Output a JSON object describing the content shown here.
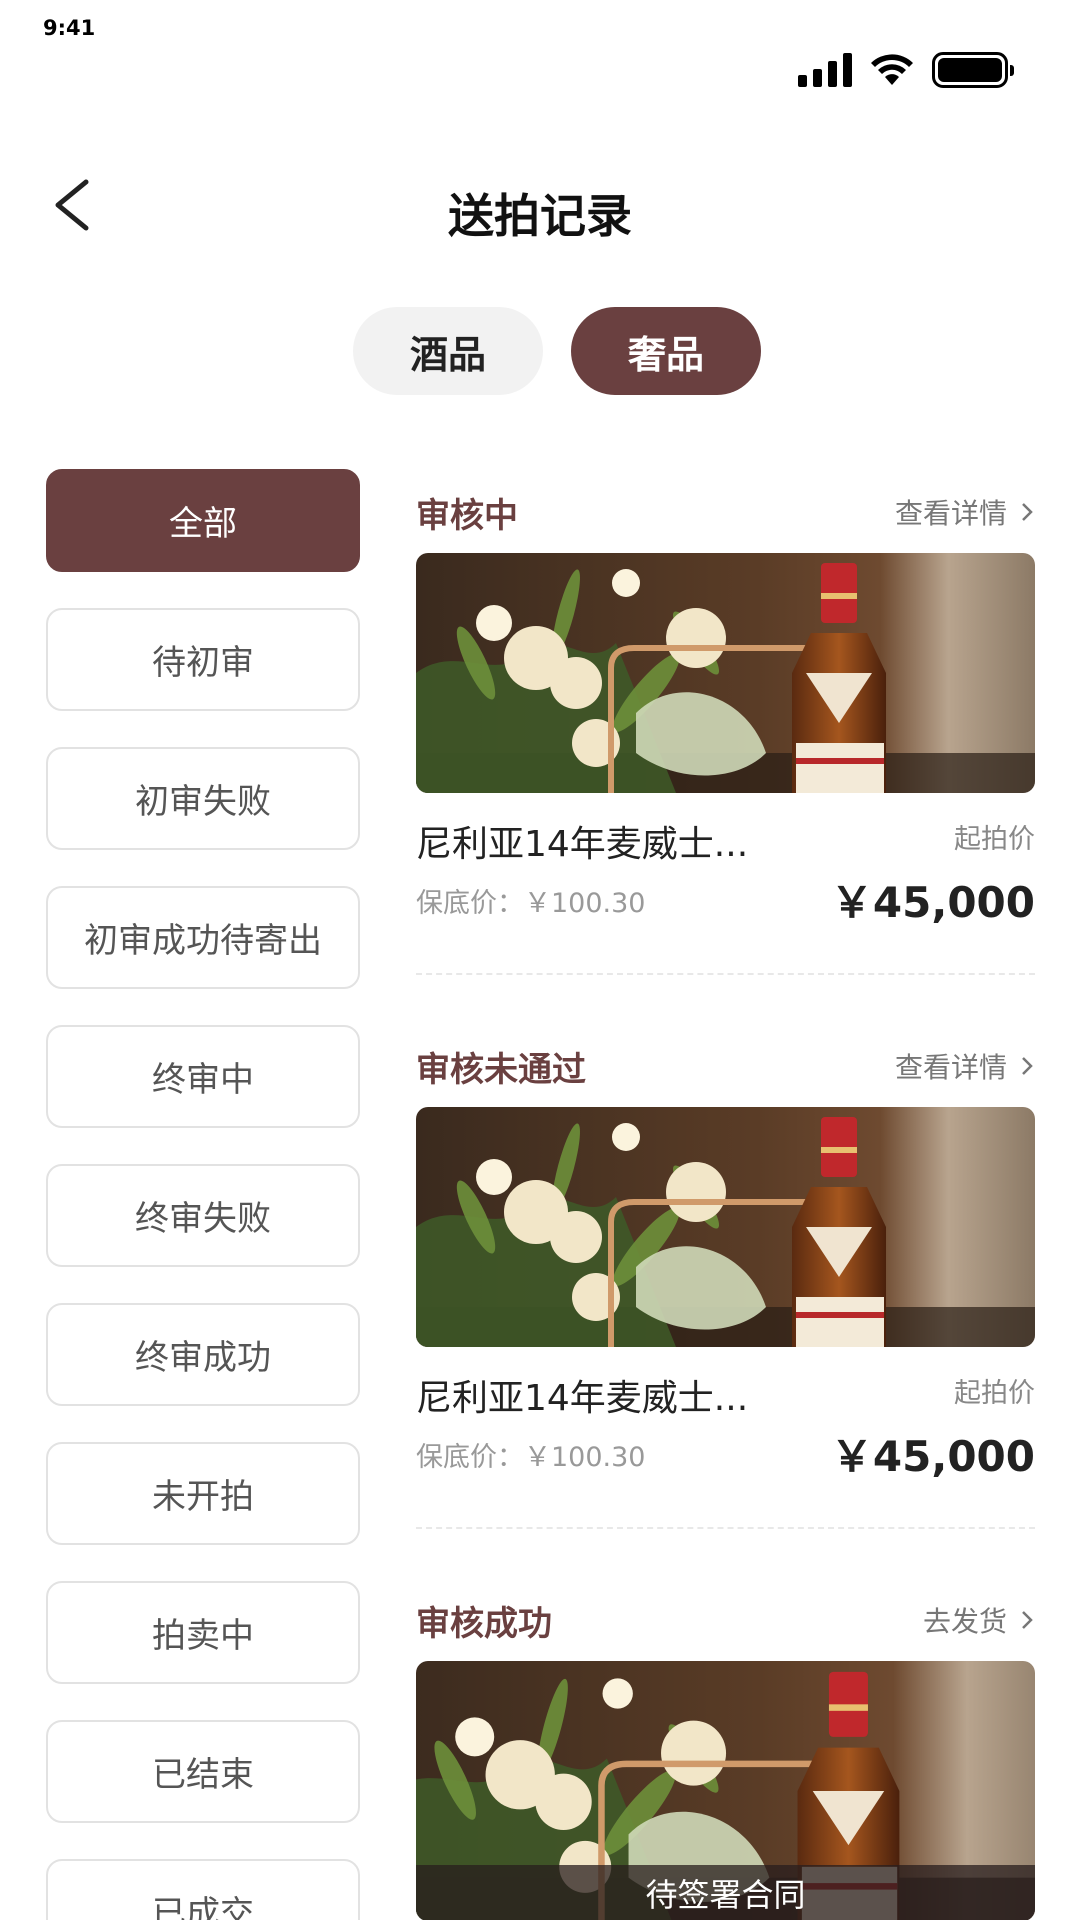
{
  "status_bar": {
    "time": "9:41",
    "icons": [
      "signal-icon",
      "wifi-icon",
      "battery-icon"
    ]
  },
  "nav": {
    "back_icon": "chevron-left-icon",
    "title": "送拍记录"
  },
  "top_tabs": [
    {
      "label": "酒品",
      "active": false
    },
    {
      "label": "奢品",
      "active": true
    }
  ],
  "filters": [
    {
      "label": "全部",
      "active": true
    },
    {
      "label": "待初审",
      "active": false
    },
    {
      "label": "初审失败",
      "active": false
    },
    {
      "label": "初审成功待寄出",
      "active": false
    },
    {
      "label": "终审中",
      "active": false
    },
    {
      "label": "终审失败",
      "active": false
    },
    {
      "label": "终审成功",
      "active": false
    },
    {
      "label": "未开拍",
      "active": false
    },
    {
      "label": "拍卖中",
      "active": false
    },
    {
      "label": "已结束",
      "active": false
    },
    {
      "label": "已成交",
      "active": false
    }
  ],
  "records": [
    {
      "status": "审核中",
      "link": "查看详情",
      "name": "尼利亚14年麦威士...",
      "start_label": "起拍价",
      "reserve_label": "保底价：",
      "reserve_price": "￥100.30",
      "start_price": "￥45,000",
      "banner": null
    },
    {
      "status": "审核未通过",
      "link": "查看详情",
      "name": "尼利亚14年麦威士...",
      "start_label": "起拍价",
      "reserve_label": "保底价：",
      "reserve_price": "￥100.30",
      "start_price": "￥45,000",
      "banner": null
    },
    {
      "status": "审核成功",
      "link": "去发货",
      "banner": "待签署合同"
    }
  ],
  "colors": {
    "accent": "#6a4040",
    "inactive_tab_bg": "#f2f2f2",
    "border": "#e2e2e2"
  }
}
